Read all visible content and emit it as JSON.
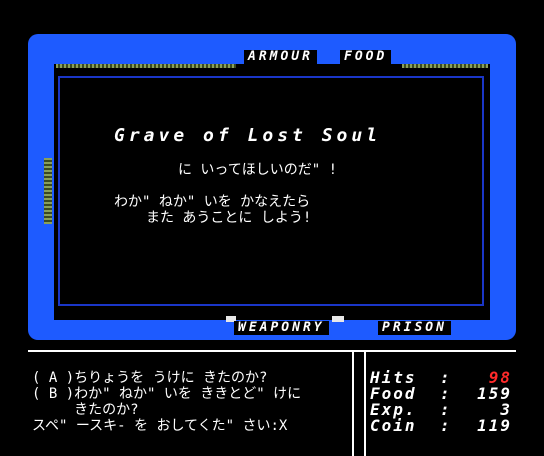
{
  "map": {
    "rooms": {
      "top_left": "ARMOUR",
      "top_right": "FOOD",
      "bottom_left": "WEAPONRY",
      "bottom_right": "PRISON"
    }
  },
  "dialog": {
    "title": "Grave of Lost Soul",
    "line2": "に いってほしいのだ\" !",
    "line3": "わか\" ねか\" いを かなえたら",
    "line4": "また あうことに しよう!"
  },
  "messages": [
    "( A )ちりょうを うけに きたのか?",
    "( B )わか\" ねか\" いを ききとど\" けに",
    "     きたのか?",
    "スペ\" ースキ- を おしてくた\" さい:X"
  ],
  "stats": {
    "hits_label": "Hits",
    "hits": "98",
    "food_label": "Food",
    "food": "159",
    "exp_label": "Exp.",
    "exp": "3",
    "coin_label": "Coin",
    "coin": "119",
    "separator": ":"
  },
  "colors": {
    "frame_blue": "#1e5bff",
    "hits_red": "#ff2a2a",
    "hedge_green": "#8aa05a"
  }
}
